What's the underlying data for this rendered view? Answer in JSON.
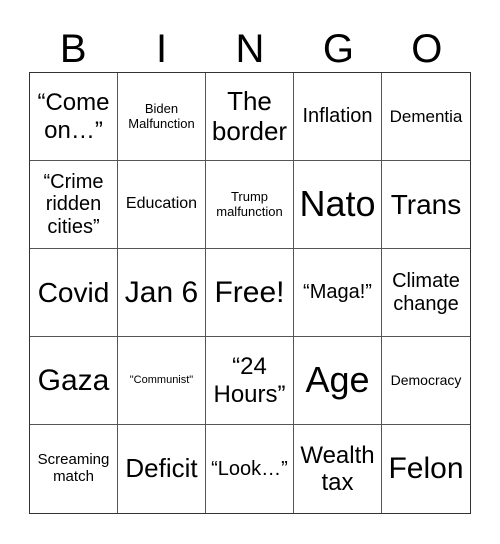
{
  "header": {
    "letters": [
      "B",
      "I",
      "N",
      "G",
      "O"
    ]
  },
  "cells": [
    "“Come on…”",
    "Biden Malfunction",
    "The border",
    "Inflation",
    "Dementia",
    "“Crime ridden cities”",
    "Education",
    "Trump malfunction",
    "Nato",
    "Trans",
    "Covid",
    "Jan 6",
    "Free!",
    "“Maga!”",
    "Climate change",
    "Gaza",
    "\"Communist\"",
    "“24 Hours”",
    "Age",
    "Democracy",
    "Screaming match",
    "Deficit",
    "“Look…”",
    "Wealth tax",
    "Felon"
  ]
}
